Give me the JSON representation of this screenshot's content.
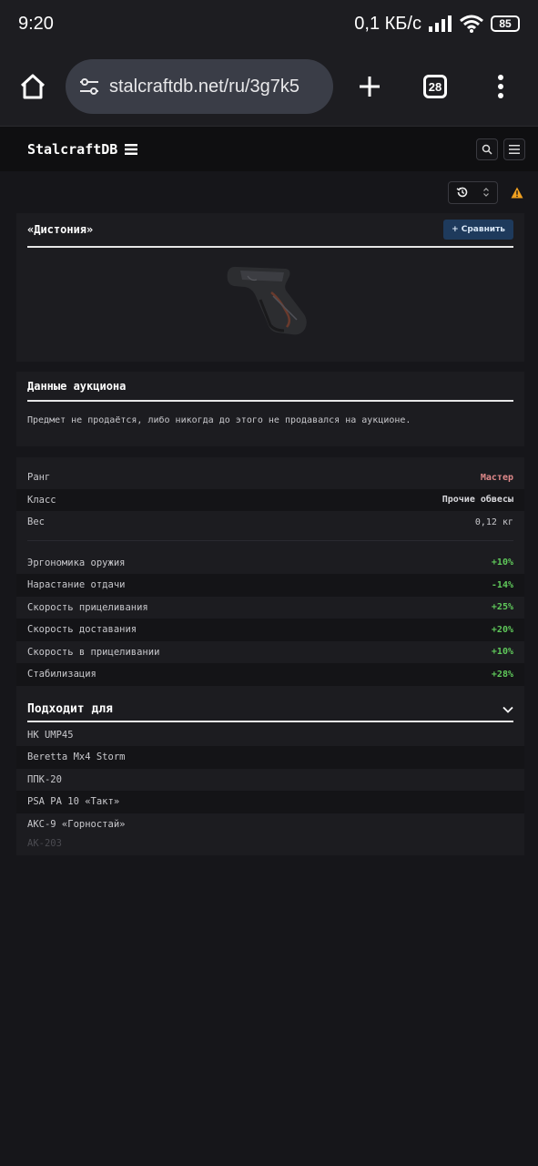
{
  "status_bar": {
    "time": "9:20",
    "network_speed": "0,1 КБ/с",
    "battery": "85",
    "colors": {
      "text": "#ffffff"
    }
  },
  "browser": {
    "url": "stalcraftdb.net/ru/3g7k5",
    "tab_count": "28"
  },
  "site": {
    "logo": "StalcraftDB"
  },
  "item": {
    "name": "«Дистония»",
    "compare_label": "+ Сравнить"
  },
  "auction": {
    "title": "Данные аукциона",
    "text": "Предмет не продаётся, либо никогда до этого не продавался на аукционе."
  },
  "stats": {
    "base": [
      {
        "label": "Ранг",
        "value": "Мастер",
        "color": "#e0898a"
      },
      {
        "label": "Класс",
        "value": "Прочие обвесы"
      },
      {
        "label": "Вес",
        "value": "0,12 кг"
      }
    ],
    "modifiers": [
      {
        "label": "Эргономика оружия",
        "value": "+10%"
      },
      {
        "label": "Нарастание отдачи",
        "value": "-14%"
      },
      {
        "label": "Скорость прицеливания",
        "value": "+25%"
      },
      {
        "label": "Скорость доставания",
        "value": "+20%"
      },
      {
        "label": "Скорость в прицеливании",
        "value": "+10%"
      },
      {
        "label": "Стабилизация",
        "value": "+28%"
      }
    ],
    "positive_color": "#5fc85a"
  },
  "fits": {
    "title": "Подходит для",
    "items": [
      "HK UMP45",
      "Beretta Mx4 Storm",
      "ППК-20",
      "PSA PA 10 «Такт»",
      "АКС-9 «Горностай»",
      "АК-203"
    ]
  },
  "icons": [
    "wifi-icon",
    "signal-icon",
    "home-icon",
    "tune-icon",
    "plus-icon",
    "more-icon",
    "list-icon",
    "search-icon",
    "menu-icon",
    "history-icon",
    "updown-icon",
    "warning-icon",
    "chevron-down-icon"
  ]
}
